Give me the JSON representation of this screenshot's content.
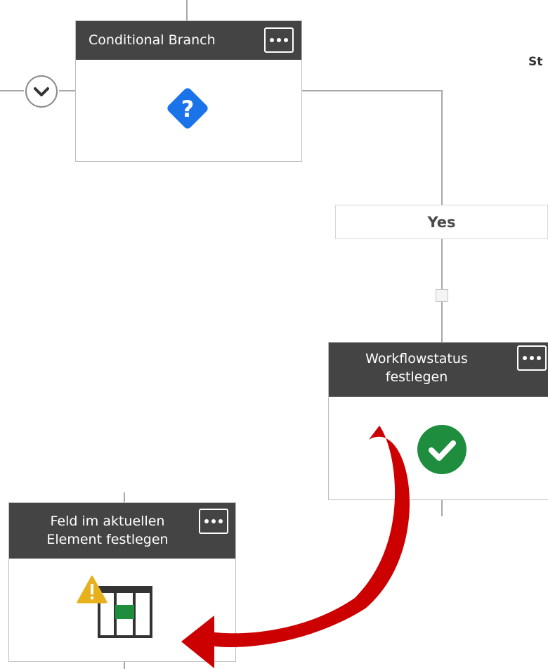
{
  "cards": {
    "conditional_branch": {
      "title": "Conditional Branch",
      "icon": "question-diamond-icon",
      "icon_color": "#1a73e8"
    },
    "workflow_status": {
      "title": "Workflowstatus festlegen",
      "icon": "check-circle-icon",
      "icon_color": "#1e8e3e"
    },
    "set_field": {
      "title": "Feld im aktuellen Element festlegen",
      "icon": "table-warning-icon",
      "warning_color": "#e6b11c",
      "accent_color": "#1e8e3e"
    }
  },
  "branch_label": "Yes",
  "side_text": "St",
  "arrow_color": "#cc0000"
}
